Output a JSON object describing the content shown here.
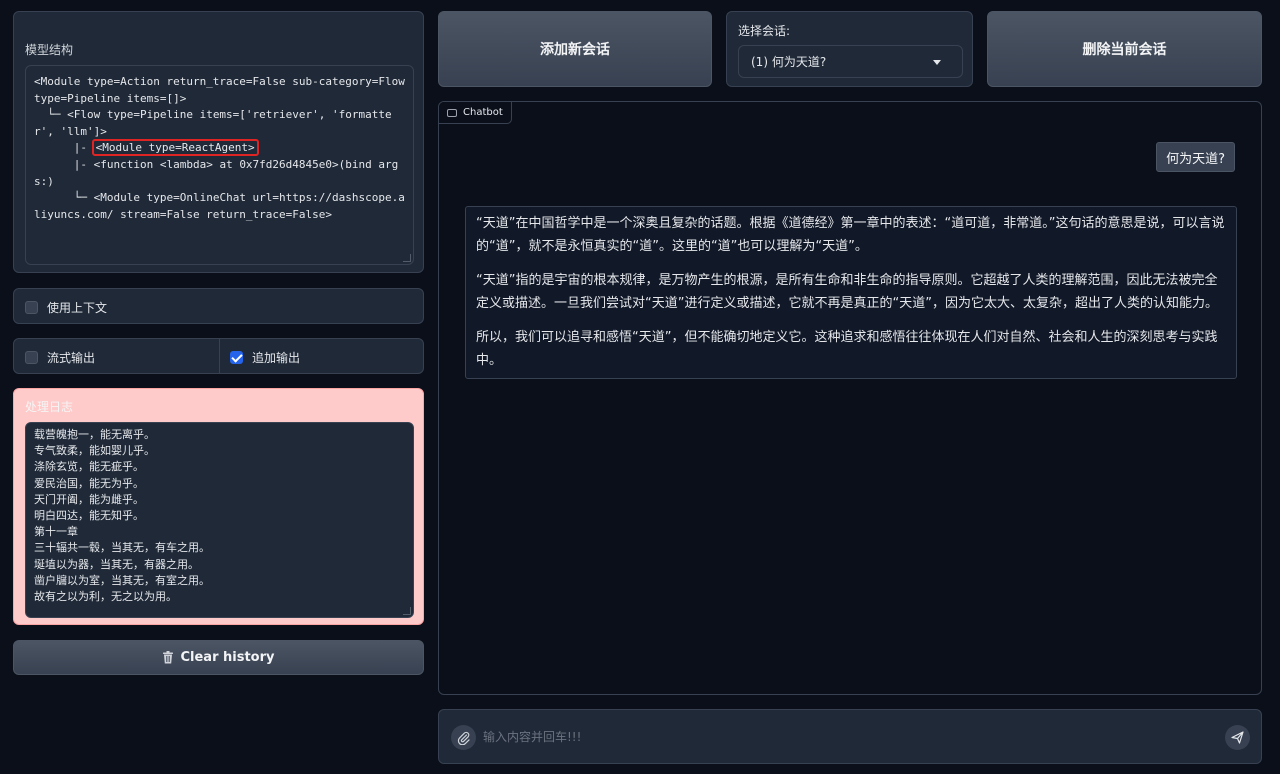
{
  "model_structure": {
    "label": "模型结构",
    "lines": [
      "<Module type=Action return_trace=False sub-category=Flow type=Pipeline items=[]>",
      "  └─ <Flow type=Pipeline items=['retriever', 'formatter', 'llm']>",
      "      |- ",
      "      |- <function <lambda> at 0x7fd26d4845e0>(bind args:)",
      "      └─ <Module type=OnlineChat url=https://dashscope.aliyuncs.com/ stream=False return_trace=False>"
    ],
    "highlighted": "<Module type=ReactAgent>"
  },
  "options": {
    "use_context": {
      "label": "使用上下文",
      "checked": false
    },
    "stream_output": {
      "label": "流式输出",
      "checked": false
    },
    "append_output": {
      "label": "追加输出",
      "checked": true
    }
  },
  "log": {
    "label": "处理日志",
    "lines": [
      "载营魄抱一，能无离乎。",
      "专气致柔，能如婴儿乎。",
      "涤除玄览，能无疵乎。",
      "爱民治国，能无为乎。",
      "天门开阖，能为雌乎。",
      "明白四达，能无知乎。",
      "第十一章",
      "三十辐共一毂，当其无，有车之用。",
      "埏埴以为器，当其无，有器之用。",
      "凿户牖以为室，当其无，有室之用。",
      "故有之以为利，无之以为用。"
    ]
  },
  "buttons": {
    "clear_history": "Clear history",
    "add_session": "添加新会话",
    "delete_session": "删除当前会话"
  },
  "session": {
    "label": "选择会话:",
    "selected": "(1)  何为天道?"
  },
  "chatbot": {
    "tag": "Chatbot",
    "user_message": "何为天道?",
    "bot_paragraphs": [
      "“天道”在中国哲学中是一个深奥且复杂的话题。根据《道德经》第一章中的表述：“道可道，非常道。”这句话的意思是说，可以言说的“道”，就不是永恒真实的“道”。这里的“道”也可以理解为“天道”。",
      "“天道”指的是宇宙的根本规律，是万物产生的根源，是所有生命和非生命的指导原则。它超越了人类的理解范围，因此无法被完全定义或描述。一旦我们尝试对“天道”进行定义或描述，它就不再是真正的“天道”，因为它太大、太复杂，超出了人类的认知能力。",
      "所以，我们可以追寻和感悟“天道”，但不能确切地定义它。这种追求和感悟往往体现在人们对自然、社会和人生的深刻思考与实践中。"
    ]
  },
  "input": {
    "placeholder": "输入内容并回车!!!"
  },
  "colors": {
    "accent": "#2563eb",
    "log_bg": "#fecaca",
    "highlight": "#e02424"
  },
  "icons": [
    "trash-icon",
    "chevron-down-icon",
    "chat-icon",
    "paperclip-icon",
    "send-icon",
    "check-icon"
  ]
}
